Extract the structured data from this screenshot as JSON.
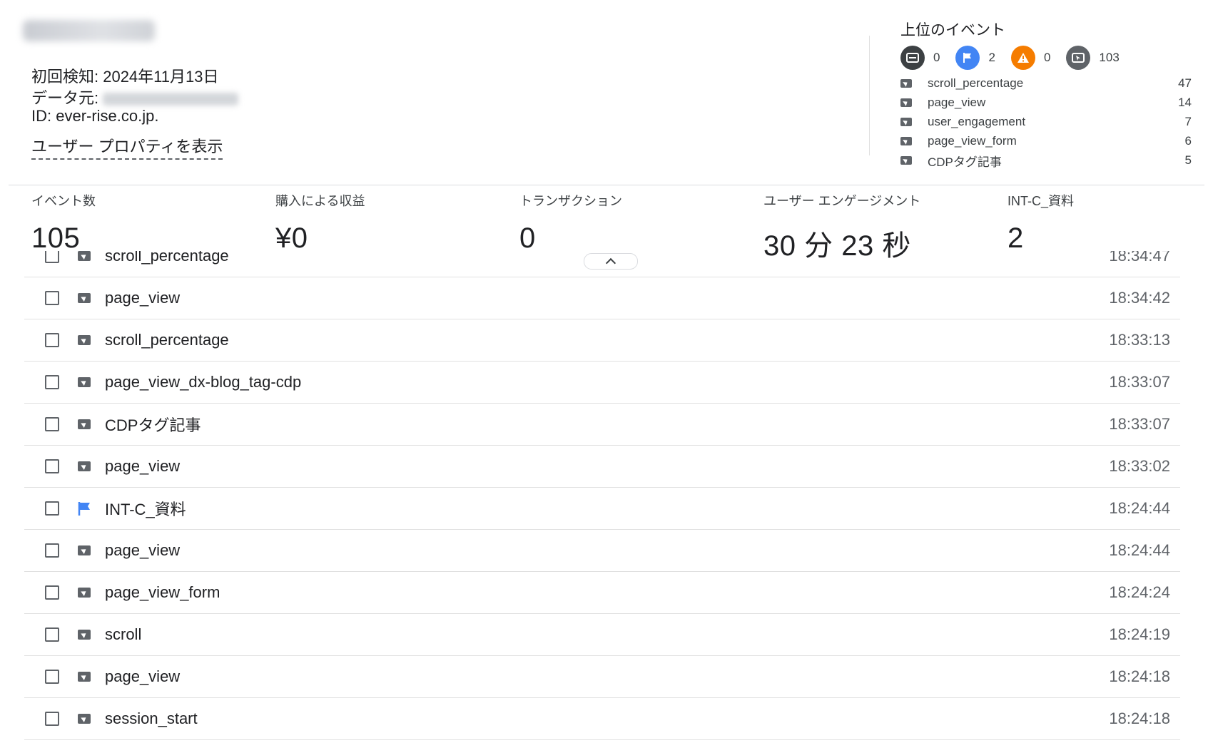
{
  "user": {
    "first_seen": "初回検知: 2024年11月13日",
    "data_source_label": "データ元:",
    "id_line": "ID: ever-rise.co.jp.",
    "view_properties": "ユーザー プロパティを表示"
  },
  "top_events": {
    "title": "上位のイベント",
    "counts": [
      {
        "icon": "page-icon",
        "color": "#3c4043",
        "value": "0"
      },
      {
        "icon": "flag-icon",
        "color": "#4285f4",
        "value": "2"
      },
      {
        "icon": "warning-icon",
        "color": "#f57c00",
        "value": "0"
      },
      {
        "icon": "cursor-icon",
        "color": "#5f6368",
        "value": "103"
      }
    ],
    "items": [
      {
        "name": "scroll_percentage",
        "count": "47"
      },
      {
        "name": "page_view",
        "count": "14"
      },
      {
        "name": "user_engagement",
        "count": "7"
      },
      {
        "name": "page_view_form",
        "count": "6"
      },
      {
        "name": "CDPタグ記事",
        "count": "5"
      }
    ]
  },
  "metrics": [
    {
      "label": "イベント数",
      "value": "105"
    },
    {
      "label": "購入による収益",
      "value": "¥0"
    },
    {
      "label": "トランザクション",
      "value": "0"
    },
    {
      "label": "ユーザー エンゲージメント",
      "value": "30 分 23 秒"
    },
    {
      "label": "INT-C_資料",
      "value": "2"
    }
  ],
  "events": [
    {
      "name": "scroll_percentage",
      "time": "18:34:47",
      "icon": "cursor-icon"
    },
    {
      "name": "page_view",
      "time": "18:34:42",
      "icon": "cursor-icon"
    },
    {
      "name": "scroll_percentage",
      "time": "18:33:13",
      "icon": "cursor-icon"
    },
    {
      "name": "page_view_dx-blog_tag-cdp",
      "time": "18:33:07",
      "icon": "cursor-icon"
    },
    {
      "name": "CDPタグ記事",
      "time": "18:33:07",
      "icon": "cursor-icon"
    },
    {
      "name": "page_view",
      "time": "18:33:02",
      "icon": "cursor-icon"
    },
    {
      "name": "INT-C_資料",
      "time": "18:24:44",
      "icon": "flag-icon"
    },
    {
      "name": "page_view",
      "time": "18:24:44",
      "icon": "cursor-icon"
    },
    {
      "name": "page_view_form",
      "time": "18:24:24",
      "icon": "cursor-icon"
    },
    {
      "name": "scroll",
      "time": "18:24:19",
      "icon": "cursor-icon"
    },
    {
      "name": "page_view",
      "time": "18:24:18",
      "icon": "cursor-icon"
    },
    {
      "name": "session_start",
      "time": "18:24:18",
      "icon": "cursor-icon"
    }
  ]
}
